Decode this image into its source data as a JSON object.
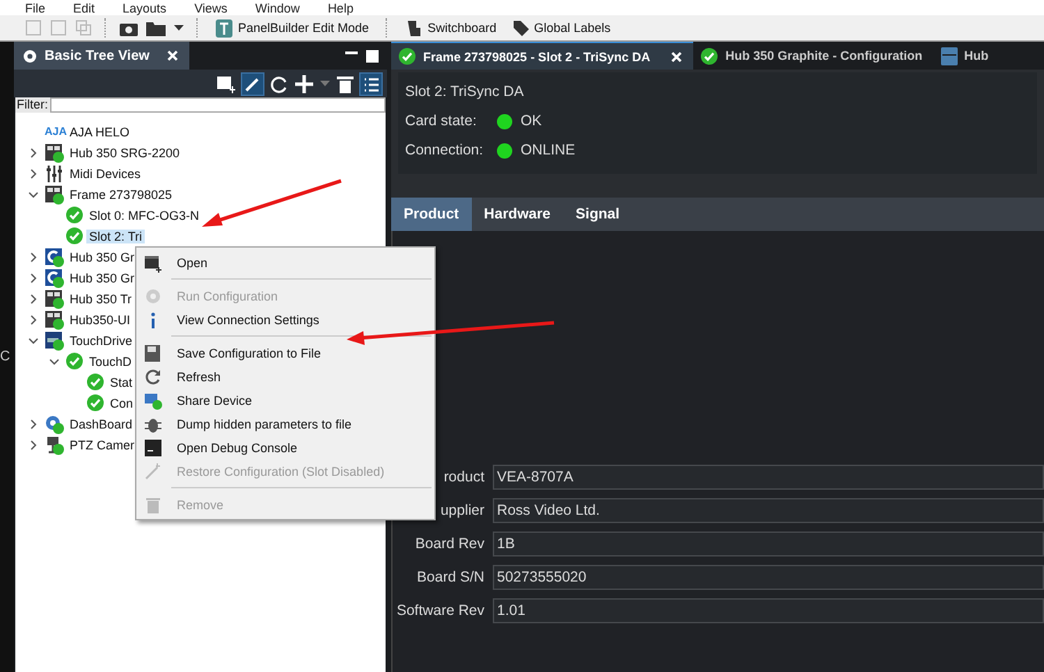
{
  "menu_bar": [
    "File",
    "Edit",
    "Layouts",
    "Views",
    "Window",
    "Help"
  ],
  "toolbar": {
    "panelbuilder": "PanelBuilder Edit Mode",
    "switchboard": "Switchboard",
    "global_labels": "Global Labels"
  },
  "left_strip": "C",
  "tree_panel": {
    "title": "Basic Tree View",
    "filter_label": "Filter:",
    "items": [
      {
        "label": "AJA HELO",
        "kind": "logo",
        "logo": "AJA",
        "selected": false
      },
      {
        "label": "Hub 350 SRG-2200",
        "kind": "frame",
        "expanded": false,
        "selected": false
      },
      {
        "label": "Midi Devices",
        "kind": "midi",
        "expanded": false,
        "selected": false
      },
      {
        "label": "Frame 273798025",
        "kind": "frame",
        "expanded": true,
        "selected": false,
        "children": [
          {
            "label": "Slot 0: MFC-OG3-N",
            "kind": "slot",
            "selected": false
          },
          {
            "label": "Slot 2: Tri",
            "kind": "slot",
            "selected": true
          }
        ]
      },
      {
        "label": "Hub 350 Gr",
        "kind": "hub",
        "expanded": false,
        "selected": false
      },
      {
        "label": "Hub 350 Gr",
        "kind": "hub",
        "expanded": false,
        "selected": false
      },
      {
        "label": "Hub 350 Tr",
        "kind": "frame",
        "expanded": false,
        "selected": false
      },
      {
        "label": "Hub350-UI",
        "kind": "frame",
        "expanded": false,
        "selected": false
      },
      {
        "label": "TouchDrive",
        "kind": "touchdrive",
        "expanded": true,
        "selected": false,
        "children": [
          {
            "label": "TouchD",
            "kind": "slot",
            "expanded": true,
            "selected": false,
            "children": [
              {
                "label": "Stat",
                "kind": "slot",
                "selected": false
              },
              {
                "label": "Con",
                "kind": "slot",
                "selected": false
              }
            ]
          }
        ]
      },
      {
        "label": "DashBoard",
        "kind": "dashboard",
        "expanded": false,
        "selected": false
      },
      {
        "label": "PTZ Camer",
        "kind": "camera",
        "expanded": false,
        "selected": false
      }
    ]
  },
  "doc_tabs": [
    {
      "label": "Frame 273798025 - Slot 2 - TriSync DA",
      "kind": "ok",
      "selected": true
    },
    {
      "label": "Hub 350 Graphite - Configuration",
      "kind": "ok",
      "selected": false
    },
    {
      "label": "Hub",
      "kind": "device",
      "selected": false
    }
  ],
  "header": {
    "title": "Slot 2: TriSync DA",
    "fields": [
      {
        "label": "Card state:",
        "value": "OK"
      },
      {
        "label": "Connection:",
        "value": "ONLINE"
      }
    ]
  },
  "content_tabs": [
    {
      "label": "Product",
      "selected": true
    },
    {
      "label": "Hardware",
      "selected": false
    },
    {
      "label": "Signal",
      "selected": false
    }
  ],
  "product_fields": [
    {
      "label": "roduct",
      "value": "VEA-8707A"
    },
    {
      "label": "upplier",
      "value": "Ross Video Ltd."
    },
    {
      "label": "Board Rev",
      "value": "1B"
    },
    {
      "label": "Board S/N",
      "value": "50273555020"
    },
    {
      "label": "Software Rev",
      "value": "1.01"
    }
  ],
  "context_menu": [
    {
      "label": "Open",
      "kind": "open",
      "disabled": false
    },
    {
      "kind": "separator"
    },
    {
      "label": "Run Configuration",
      "kind": "gear",
      "disabled": true
    },
    {
      "label": "View Connection Settings",
      "kind": "info",
      "disabled": false
    },
    {
      "kind": "separator"
    },
    {
      "label": "Save Configuration to File",
      "kind": "save",
      "disabled": false
    },
    {
      "label": "Refresh",
      "kind": "refresh",
      "disabled": false
    },
    {
      "label": "Share Device",
      "kind": "share",
      "disabled": false
    },
    {
      "label": "Dump hidden parameters to file",
      "kind": "bug",
      "disabled": false
    },
    {
      "label": "Open Debug Console",
      "kind": "console",
      "disabled": false
    },
    {
      "label": "Restore Configuration (Slot Disabled)",
      "kind": "wand",
      "disabled": true
    },
    {
      "kind": "separator"
    },
    {
      "label": "Remove",
      "kind": "trash",
      "disabled": true
    }
  ]
}
